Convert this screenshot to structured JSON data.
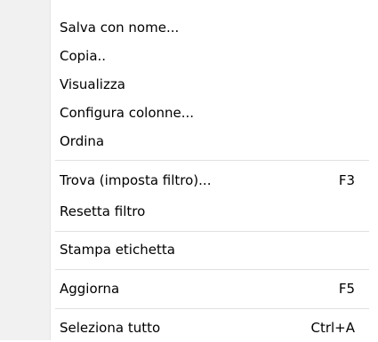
{
  "menu": {
    "items": [
      {
        "label": "Salva con nome...",
        "shortcut": ""
      },
      {
        "label": "Copia..",
        "shortcut": ""
      },
      {
        "label": "Visualizza",
        "shortcut": ""
      },
      {
        "label": "Configura colonne...",
        "shortcut": ""
      },
      {
        "label": "Ordina",
        "shortcut": ""
      },
      {
        "label": "Trova (imposta filtro)...",
        "shortcut": "F3"
      },
      {
        "label": "Resetta filtro",
        "shortcut": ""
      },
      {
        "label": "Stampa etichetta",
        "shortcut": ""
      },
      {
        "label": "Aggiorna",
        "shortcut": "F5"
      },
      {
        "label": "Seleziona tutto",
        "shortcut": "Ctrl+A"
      }
    ]
  },
  "colors": {
    "gutter": "#f1f1f1",
    "separator": "#e0e0e0",
    "text": "#000000",
    "background": "#ffffff"
  }
}
